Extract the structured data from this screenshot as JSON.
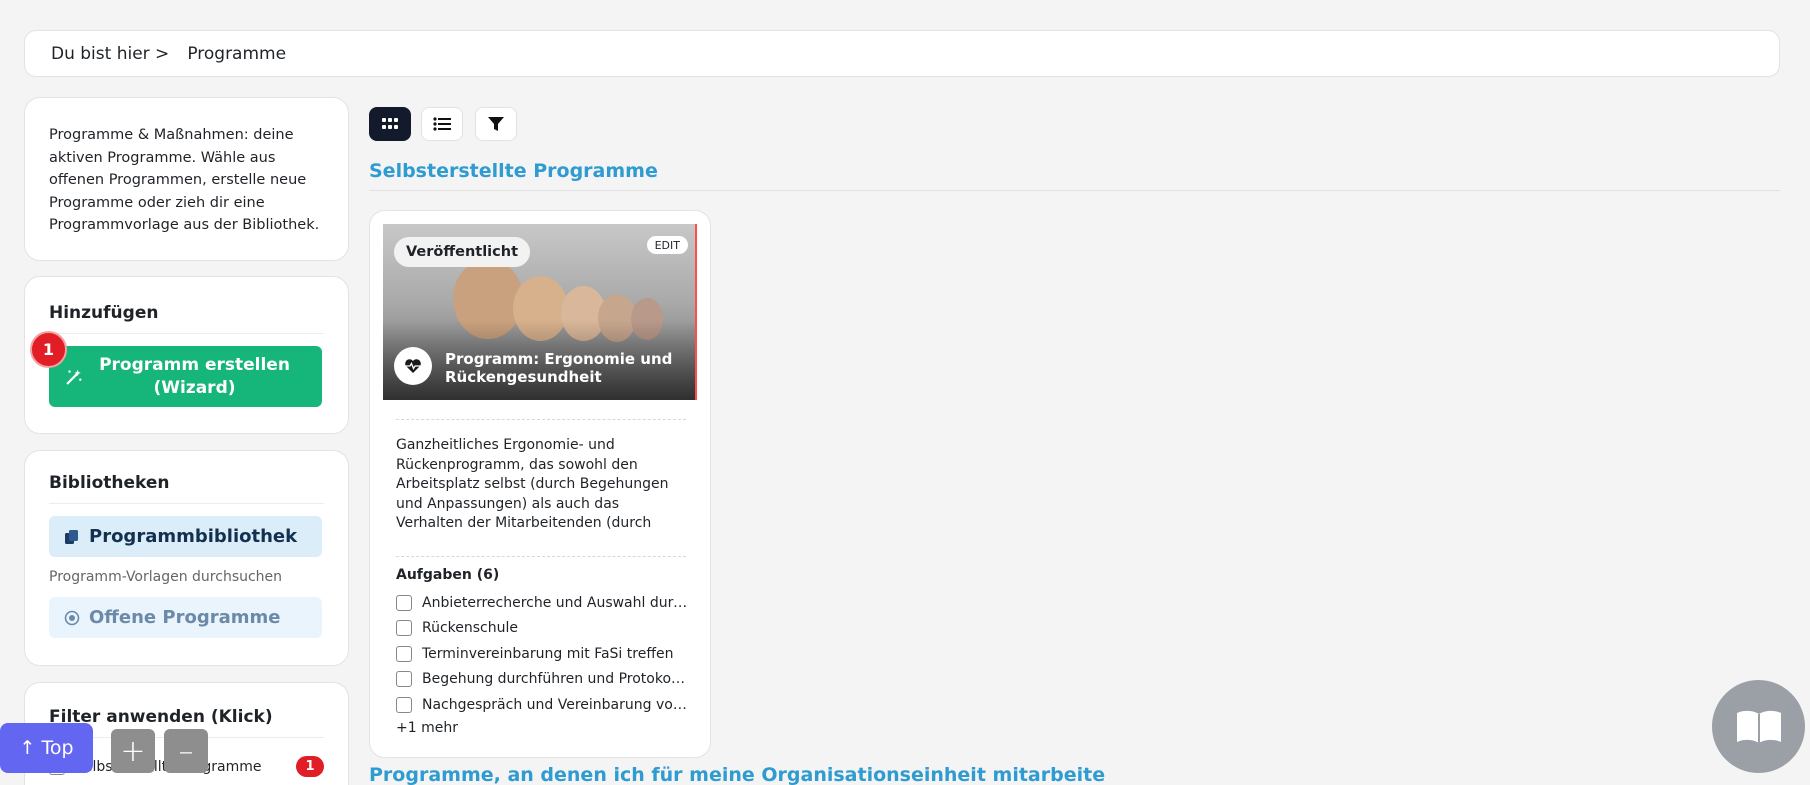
{
  "breadcrumb": {
    "prefix": "Du bist hier >",
    "current": "Programme"
  },
  "intro": {
    "text": "Programme & Maßnahmen: deine aktiven Programme. Wähle aus offenen Programmen, erstelle neue Programme oder zieh dir eine Programmvorlage aus der Bibliothek."
  },
  "add": {
    "title": "Hinzufügen",
    "create_label": "Programm erstellen (Wizard)",
    "step_badge": "1"
  },
  "libraries": {
    "title": "Bibliotheken",
    "program_library": "Programmbibliothek",
    "program_library_sub": "Programm-Vorlagen durchsuchen",
    "open_programs": "Offene Programme"
  },
  "filters": {
    "title": "Filter anwenden (Klick)",
    "items": [
      {
        "label": "Selbsterstellte Programme",
        "count": "1"
      }
    ]
  },
  "floating": {
    "top_label": "↑ Top",
    "zoom_in": "+",
    "zoom_out": "–"
  },
  "sections": {
    "own": "Selbsterstellte Programme",
    "org": "Programme, an denen ich für meine Organisationseinheit mitarbeite"
  },
  "program_card": {
    "status": "Veröffentlicht",
    "edit": "EDIT",
    "title": "Programm: Ergonomie und Rückengesundheit",
    "description": "Ganzheitliches Ergonomie- und Rückenprogramm, das sowohl den Arbeitsplatz selbst (durch Begehungen und Anpassungen) als auch das Verhalten der Mitarbeitenden (durch Unterweisungen, Rückenschule und zusätzliche Maßnahmen)",
    "tasks_title": "Aufgaben (6)",
    "tasks": [
      "Anbieterrecherche und Auswahl durch…",
      "Rückenschule",
      "Terminvereinbarung mit FaSi treffen",
      "Begehung durchführen und Protokoll …",
      "Nachgespräch und Vereinbarung von …"
    ],
    "more": "+1 mehr"
  },
  "colors": {
    "accent": "#2e9bd1",
    "create_green": "#16b67a",
    "badge_red": "#e11d25",
    "top_purple": "#6366f1"
  }
}
